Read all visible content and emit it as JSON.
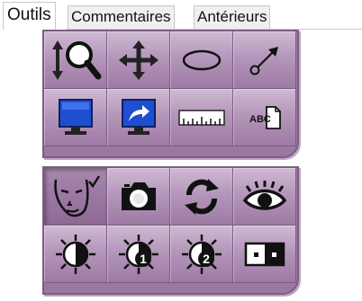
{
  "tabs": [
    {
      "label": "Outils",
      "active": true
    },
    {
      "label": "Commentaires",
      "active": false
    },
    {
      "label": "Antérieurs",
      "active": false
    }
  ],
  "tools_panel": {
    "buttons": [
      {
        "name": "zoom-button",
        "icon": "zoom-magnifier-icon"
      },
      {
        "name": "pan-button",
        "icon": "move-arrows-icon"
      },
      {
        "name": "ellipse-button",
        "icon": "ellipse-icon"
      },
      {
        "name": "arrow-button",
        "icon": "arrow-icon"
      },
      {
        "name": "monitor-button",
        "icon": "monitor-icon"
      },
      {
        "name": "share-monitor-button",
        "icon": "share-monitor-icon"
      },
      {
        "name": "ruler-button",
        "icon": "ruler-icon"
      },
      {
        "name": "text-annotation-button",
        "icon": "text-annotation-icon",
        "text": "ABC"
      }
    ]
  },
  "image_panel": {
    "buttons": [
      {
        "name": "face-checked-button",
        "icon": "face-check-icon",
        "selected": true
      },
      {
        "name": "camera-button",
        "icon": "camera-icon"
      },
      {
        "name": "refresh-button",
        "icon": "refresh-icon"
      },
      {
        "name": "eye-button",
        "icon": "eye-icon"
      },
      {
        "name": "contrast-button",
        "icon": "contrast-icon"
      },
      {
        "name": "contrast-1-button",
        "icon": "contrast-1-icon",
        "text": "1"
      },
      {
        "name": "contrast-2-button",
        "icon": "contrast-2-icon",
        "text": "2"
      },
      {
        "name": "pixel-button",
        "icon": "pixel-dots-icon"
      }
    ]
  },
  "colors": {
    "panel_border": "#7e5c86",
    "button_light": "#cfbad3",
    "button_dark": "#9d7aa3",
    "icon_blue": "#1e4fd0"
  }
}
